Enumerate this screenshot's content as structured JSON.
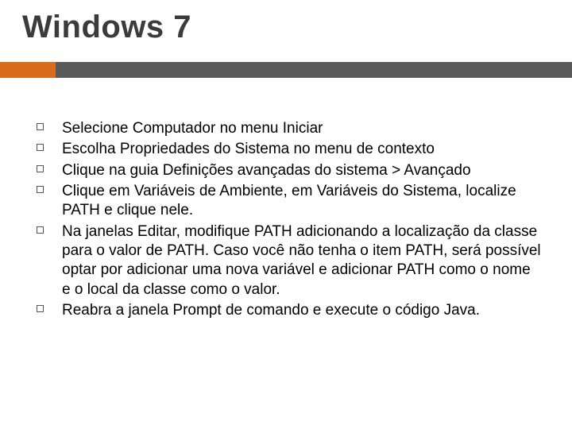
{
  "title": "Windows 7",
  "bullets": [
    "Selecione Computador no menu Iniciar",
    "Escolha Propriedades do Sistema no menu de contexto",
    "Clique na guia Definições avançadas do sistema > Avançado",
    "Clique em Variáveis de Ambiente, em Variáveis do Sistema, localize PATH e clique nele.",
    "Na janelas Editar, modifique PATH adicionando a localização da classe para o valor de PATH. Caso você não tenha o item PATH, será possível optar por adicionar uma nova variável e adicionar PATH como o nome e o local da classe como o valor.",
    "Reabra a janela Prompt de comando e execute o código Java."
  ]
}
